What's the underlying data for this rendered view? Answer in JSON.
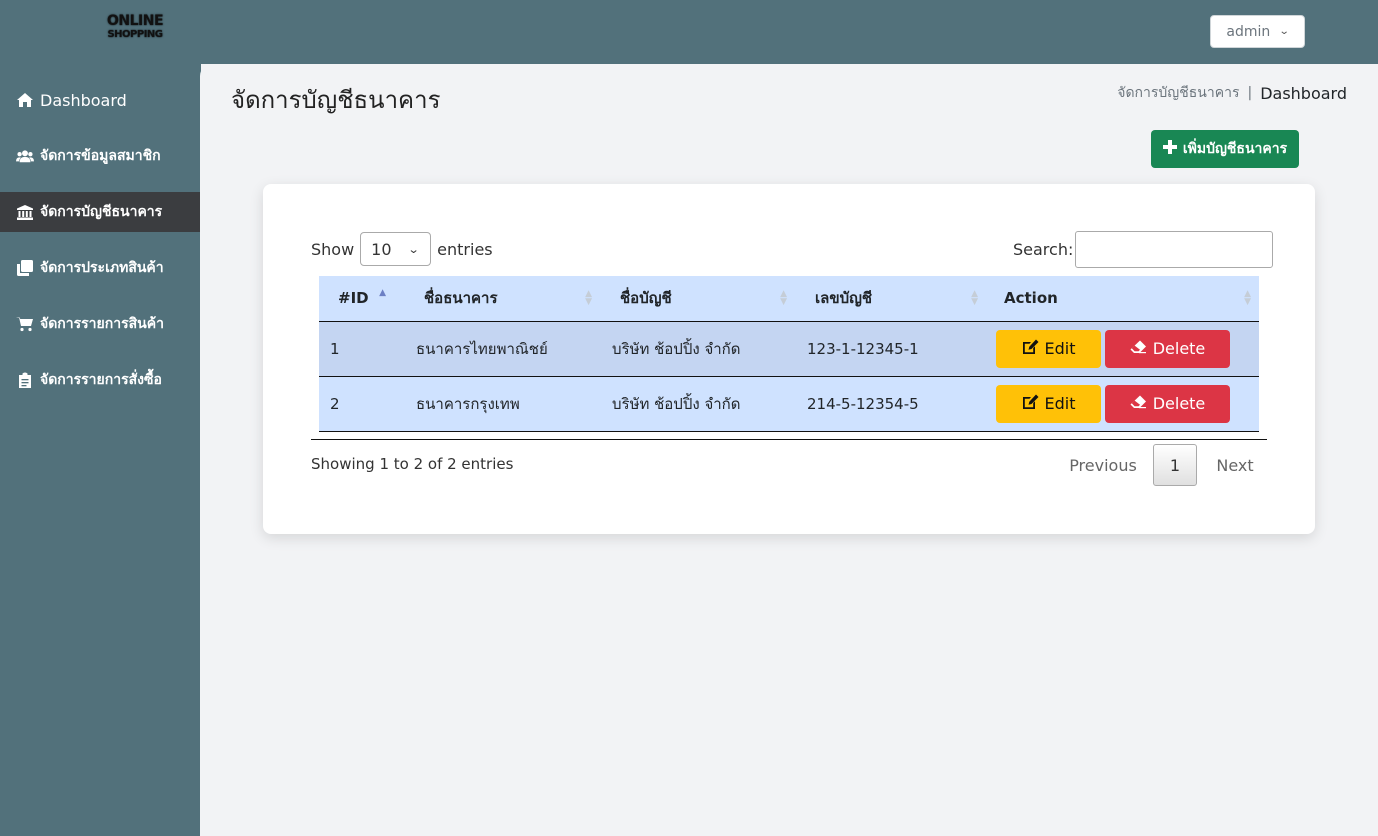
{
  "header": {
    "logo_line1": "ONLINE",
    "logo_line2": "SHOPPING",
    "user_menu_label": "admin"
  },
  "sidebar": {
    "items": [
      {
        "label": "Dashboard",
        "icon": "home-icon"
      },
      {
        "label": "จัดการข้อมูลสมาชิก",
        "icon": "users-icon"
      },
      {
        "label": "จัดการบัญชีธนาคาร",
        "icon": "bank-icon",
        "active": true
      },
      {
        "label": "จัดการประเภทสินค้า",
        "icon": "clone-icon"
      },
      {
        "label": "จัดการรายการสินค้า",
        "icon": "cart-icon"
      },
      {
        "label": "จัดการรายการสั่งซื้อ",
        "icon": "clipboard-icon"
      }
    ]
  },
  "page": {
    "title": "จัดการบัญชีธนาคาร",
    "breadcrumb": [
      "จัดการบัญชีธนาคาร",
      "Dashboard"
    ],
    "breadcrumb_sep": "|",
    "add_button_label": "เพิ่มบัญชีธนาคาร"
  },
  "table_controls": {
    "show_label": "Show",
    "entries_label": "entries",
    "page_length": "10",
    "search_label": "Search:",
    "search_value": ""
  },
  "table": {
    "columns": [
      "#ID",
      "ชื่อธนาคาร",
      "ชื่อบัญชี",
      "เลขบัญชี",
      "Action"
    ],
    "rows": [
      {
        "id": "1",
        "bank": "ธนาคารไทยพาณิชย์",
        "account_name": "บริษัท ช้อปปิ้ง จำกัด",
        "account_no": "123-1-12345-1"
      },
      {
        "id": "2",
        "bank": "ธนาคารกรุงเทพ",
        "account_name": "บริษัท ช้อปปิ้ง จำกัด",
        "account_no": "214-5-12354-5"
      }
    ],
    "edit_label": "Edit",
    "delete_label": "Delete"
  },
  "footer": {
    "info": "Showing 1 to 2 of 2 entries",
    "prev_label": "Previous",
    "current_page": "1",
    "next_label": "Next"
  },
  "colors": {
    "topbar": "#52717b",
    "sidebar_active": "#3b3d40",
    "add_button": "#198754",
    "edit_button": "#ffc107",
    "delete_button": "#dc3545",
    "table_header": "#cfe2ff"
  }
}
